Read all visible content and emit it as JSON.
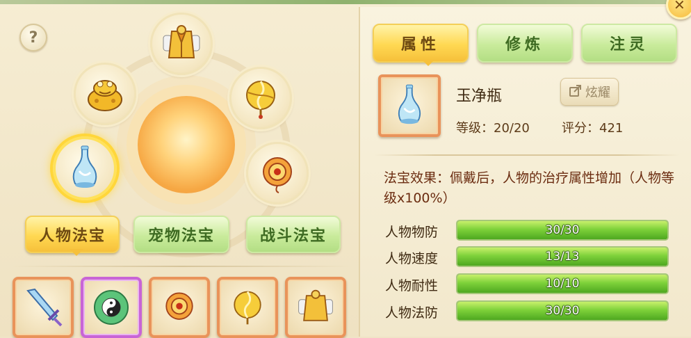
{
  "help": {
    "label": "?"
  },
  "left_tabs": [
    {
      "label": "人物法宝",
      "active": true
    },
    {
      "label": "宠物法宝",
      "active": false
    },
    {
      "label": "战斗法宝",
      "active": false
    }
  ],
  "orbs": [
    {
      "icon": "golden-vest-icon"
    },
    {
      "icon": "golden-toad-icon"
    },
    {
      "icon": "golden-fan-icon"
    },
    {
      "icon": "jade-vase-icon",
      "selected": true
    },
    {
      "icon": "fire-seal-icon"
    }
  ],
  "slots": [
    {
      "icon": "crystal-sword-icon"
    },
    {
      "icon": "yin-yang-jade-icon"
    },
    {
      "icon": "fire-seal-icon"
    },
    {
      "icon": "golden-fan-icon"
    },
    {
      "icon": "golden-vest-icon"
    }
  ],
  "right_tabs": [
    {
      "label": "属性",
      "active": true
    },
    {
      "label": "修炼",
      "active": false
    },
    {
      "label": "注灵",
      "active": false
    }
  ],
  "item": {
    "name": "玉净瓶",
    "share_label": "炫耀",
    "level_text": "等级：20/20",
    "score_text": "评分：421"
  },
  "effect": {
    "text": "法宝效果：佩戴后，人物的治疗属性增加（人物等级x100%）"
  },
  "stats": [
    {
      "label": "人物物防",
      "value_text": "30/30",
      "fraction": 1.0
    },
    {
      "label": "人物速度",
      "value_text": "13/13",
      "fraction": 1.0
    },
    {
      "label": "人物耐性",
      "value_text": "10/10",
      "fraction": 1.0
    },
    {
      "label": "人物法防",
      "value_text": "30/30",
      "fraction": 1.0
    }
  ],
  "colors": {
    "tab_active": "#ffd852",
    "tab_inactive": "#c9eb9b",
    "bar_fill": "#7ed13a",
    "slot_border": "#e9935a",
    "slot_border_rare": "#c864d6"
  }
}
